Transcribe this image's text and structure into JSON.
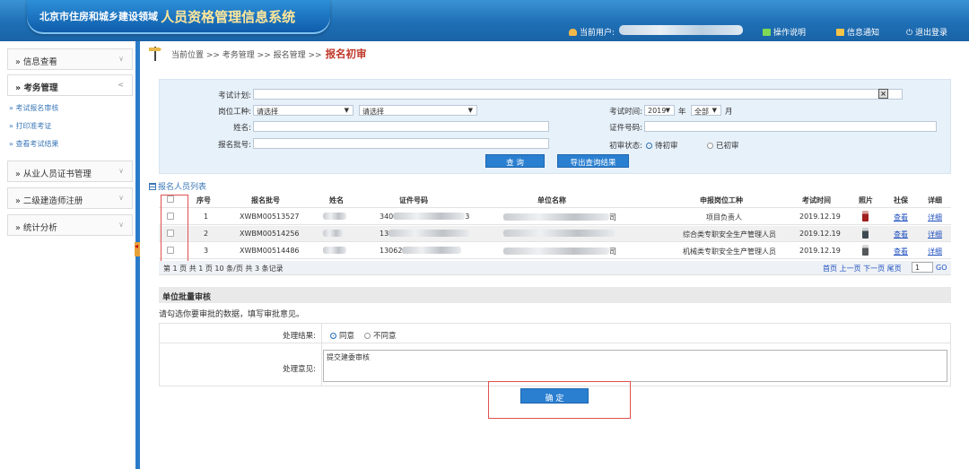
{
  "header": {
    "title_prefix": "北京市住房和城乡建设领域",
    "title_main": "人员资格管理信息系统",
    "current_user_label": "当前用户:",
    "help_label": "操作说明",
    "notice_label": "信息通知",
    "logout_label": "退出登录",
    "icons": [
      "user-icon",
      "help-icon",
      "mail-icon",
      "power-icon"
    ]
  },
  "sidebar": {
    "items": [
      {
        "label": "信息查看",
        "chevron": "∨"
      },
      {
        "label": "考务管理",
        "chevron": "<"
      },
      {
        "label": "从业人员证书管理",
        "chevron": "∨"
      },
      {
        "label": "二级建造师注册",
        "chevron": "∨"
      },
      {
        "label": "统计分析",
        "chevron": "∨"
      }
    ],
    "sub_items": [
      "考试报名审核",
      "打印准考证",
      "查看考试结果"
    ]
  },
  "breadcrumb": {
    "prefix": "当前位置 >> 考务管理 >> 报名管理 >>",
    "current": "报名初审"
  },
  "search": {
    "exam_plan_label": "考试计划:",
    "job_type_label": "岗位工种:",
    "job_type_select_1": "请选择",
    "job_type_select_2": "请选择",
    "name_label": "姓名:",
    "batch_label": "报名批号:",
    "exam_time_label": "考试时间:",
    "year_value": "2019",
    "year_unit": "年",
    "month_value": "全部",
    "month_unit": "月",
    "cert_no_label": "证件号码:",
    "status_label": "初审状态:",
    "status_options": [
      "待初审",
      "已初审"
    ],
    "search_button": "查 询",
    "export_button": "导出查询结果"
  },
  "table": {
    "title": "报名人员列表",
    "columns": [
      "序号",
      "报名批号",
      "姓名",
      "证件号码",
      "单位名称",
      "申报岗位工种",
      "考试时间",
      "照片",
      "社保",
      "详细"
    ],
    "rows": [
      {
        "index": "1",
        "batch_no": "XWBM00513527",
        "id_prefix": "340",
        "id_suffix": "3",
        "unit_suffix": "司",
        "job": "项目负责人",
        "exam_time": "2019.12.19",
        "social": "查看",
        "detail": "详细"
      },
      {
        "index": "2",
        "batch_no": "XWBM00514256",
        "id_prefix": "13",
        "id_suffix": "",
        "unit_suffix": "",
        "job": "综合类专职安全生产管理人员",
        "exam_time": "2019.12.19",
        "social": "查看",
        "detail": "详细"
      },
      {
        "index": "3",
        "batch_no": "XWBM00514486",
        "id_prefix": "13062",
        "id_suffix": "",
        "unit_suffix": "司",
        "job": "机械类专职安全生产管理人员",
        "exam_time": "2019.12.19",
        "social": "查看",
        "detail": "详细"
      }
    ]
  },
  "pager": {
    "info": "第 1 页  共 1 页  10 条/页  共 3 条记录",
    "nav": "首页 上一页 下一页 尾页",
    "page_value": "1",
    "go_label": "GO"
  },
  "batch": {
    "header": "单位批量审核",
    "tip": "请勾选你要审批的数据，填写审批意见。",
    "result_label": "处理结果:",
    "result_options": [
      "同意",
      "不同意"
    ],
    "opinion_label": "处理意见:",
    "opinion_value": "提交建委审核",
    "confirm_button": "确 定"
  }
}
